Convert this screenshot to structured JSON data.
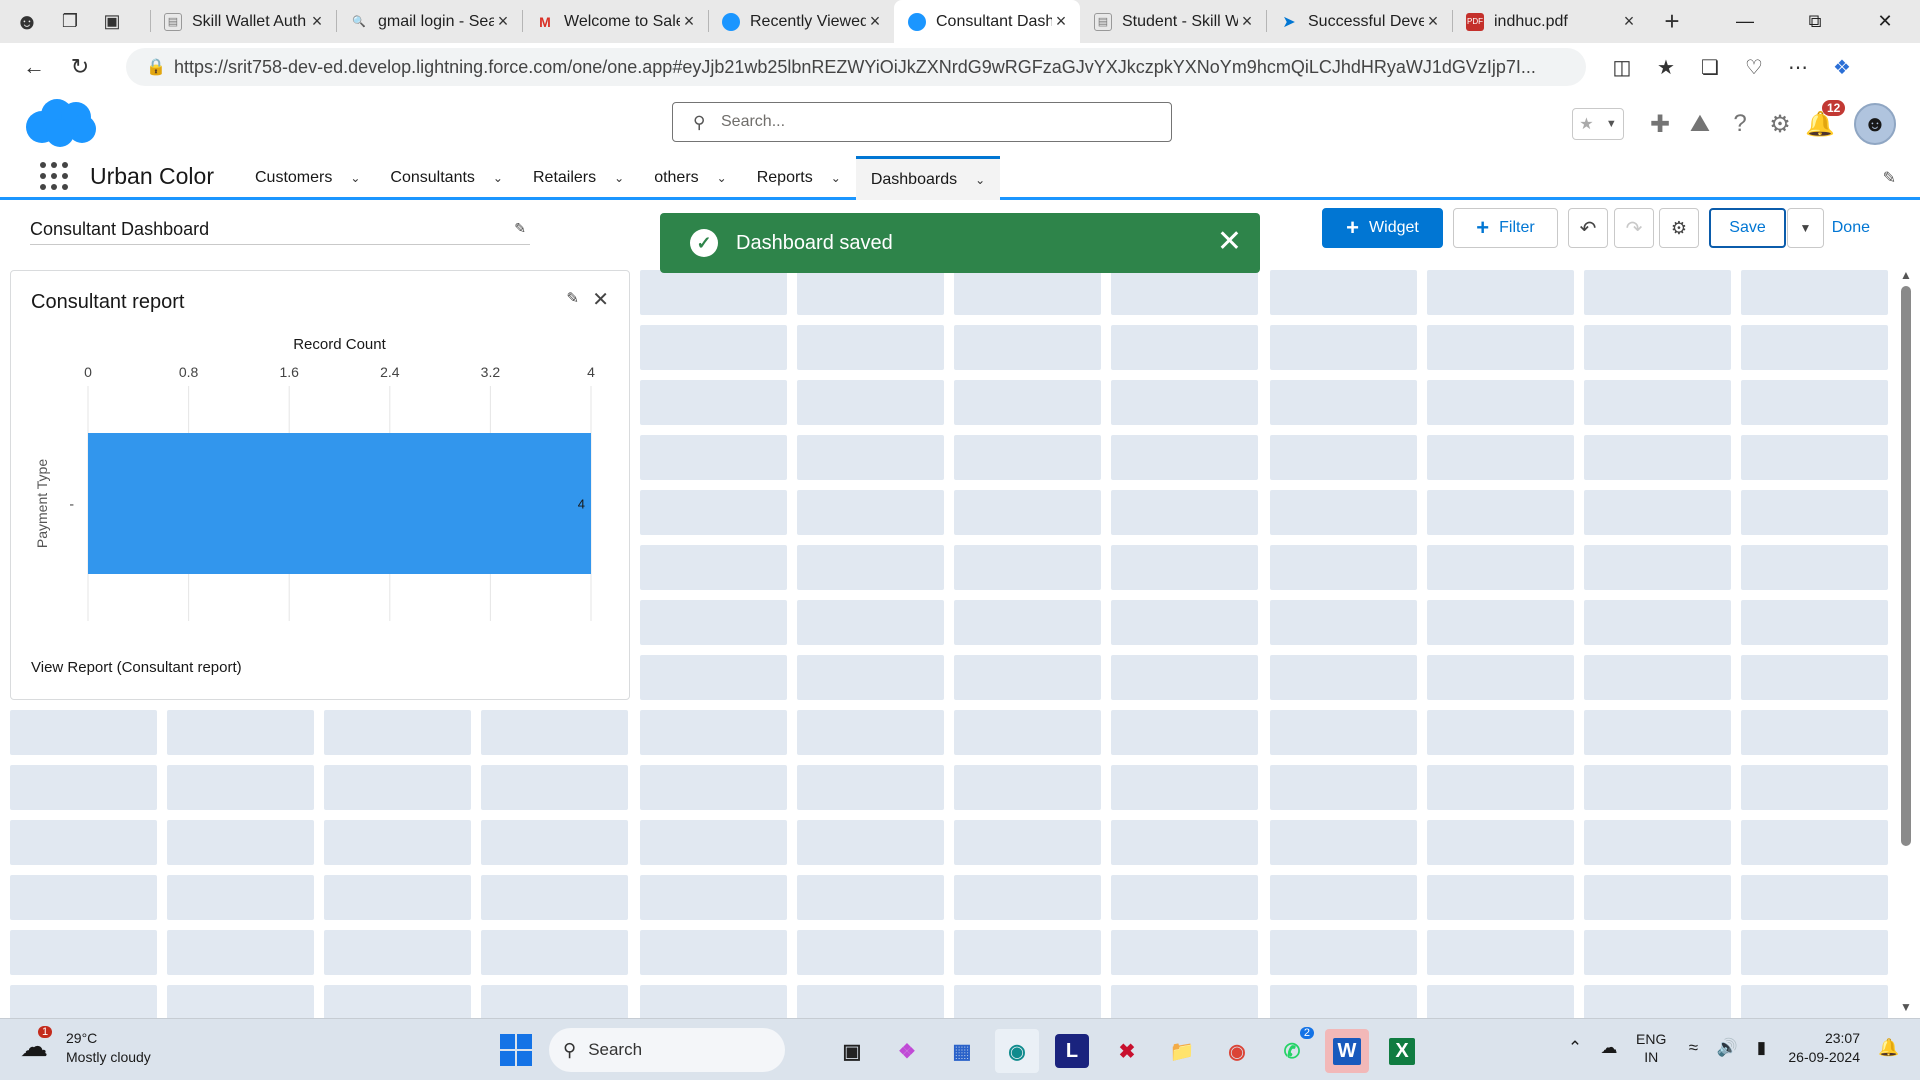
{
  "browser": {
    "tabs": [
      {
        "title": "Skill Wallet Auth",
        "icon": "page-icon"
      },
      {
        "title": "gmail login - Sea",
        "icon": "search-icon"
      },
      {
        "title": "Welcome to Sale",
        "icon": "gmail-icon"
      },
      {
        "title": "Recently Viewed",
        "icon": "salesforce-icon"
      },
      {
        "title": "Consultant Dash",
        "icon": "salesforce-icon",
        "active": true
      },
      {
        "title": "Student - Skill W",
        "icon": "page-icon"
      },
      {
        "title": "Successful Devel",
        "icon": "bolt-icon"
      },
      {
        "title": "indhuc.pdf",
        "icon": "pdf-icon"
      }
    ],
    "url": "https://srit758-dev-ed.develop.lightning.force.com/one/one.app#eyJjb21wb25lbnREZWYiOiJkZXNrdG9wRGFzaGJvYXJkczpkYXNoYm9hcmQiLCJhdHRyaWJ1dGVzIjp7I..."
  },
  "sf": {
    "search_placeholder": "Search...",
    "notification_count": "12",
    "app_name": "Urban Color",
    "nav": [
      {
        "label": "Customers"
      },
      {
        "label": "Consultants"
      },
      {
        "label": "Retailers"
      },
      {
        "label": "others"
      },
      {
        "label": "Reports"
      },
      {
        "label": "Dashboards",
        "active": true
      }
    ]
  },
  "dashboard": {
    "title": "Consultant Dashboard",
    "toast": "Dashboard saved",
    "buttons": {
      "widget": "Widget",
      "filter": "Filter",
      "save": "Save",
      "done": "Done"
    }
  },
  "widget": {
    "title": "Consultant report",
    "footer_link": "View Report (Consultant report)"
  },
  "chart_data": {
    "type": "bar",
    "orientation": "horizontal",
    "title": "Record Count",
    "xlabel": "Record Count",
    "ylabel": "Payment Type",
    "categories": [
      "-"
    ],
    "values": [
      4
    ],
    "data_labels": [
      "4"
    ],
    "xticks": [
      "0",
      "0.8",
      "1.6",
      "2.4",
      "3.2",
      "4"
    ],
    "xlim": [
      0,
      4
    ],
    "grid": true,
    "bar_color": "#3296ed"
  },
  "taskbar": {
    "weather_temp": "29°C",
    "weather_desc": "Mostly cloudy",
    "weather_badge": "1",
    "search_label": "Search",
    "whatsapp_badge": "2",
    "lang_top": "ENG",
    "lang_bottom": "IN",
    "time": "23:07",
    "date": "26-09-2024"
  },
  "colors": {
    "brand": "#0176d3",
    "toast": "#2e844a",
    "grid_cell": "#e1e8f1"
  }
}
